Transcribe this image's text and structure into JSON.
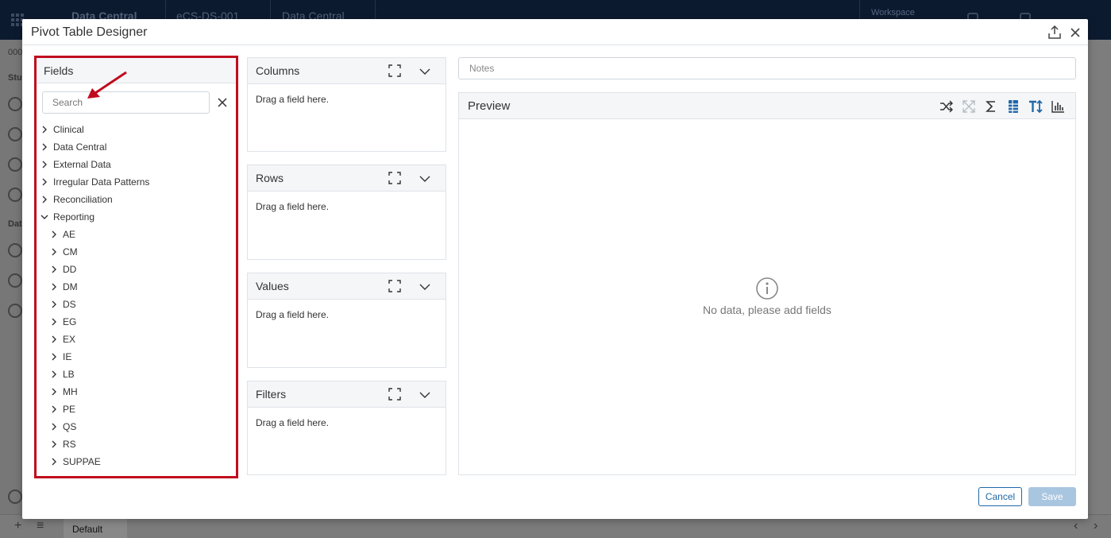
{
  "background": {
    "topbar_items": [
      "Data Central",
      "eCS-DS-001",
      "Data Central"
    ],
    "workspace_label": "Workspace",
    "left_labels": [
      "000",
      "Stu",
      "Dat"
    ],
    "bottom_tab": "Default"
  },
  "dialog": {
    "title": "Pivot Table Designer",
    "icons": {
      "export": "export-icon",
      "close": "close-icon"
    }
  },
  "fields": {
    "title": "Fields",
    "search_placeholder": "Search",
    "tree": [
      {
        "label": "Clinical",
        "expanded": false,
        "level": 0
      },
      {
        "label": "Data Central",
        "expanded": false,
        "level": 0
      },
      {
        "label": "External Data",
        "expanded": false,
        "level": 0
      },
      {
        "label": "Irregular Data Patterns",
        "expanded": false,
        "level": 0
      },
      {
        "label": "Reconciliation",
        "expanded": false,
        "level": 0
      },
      {
        "label": "Reporting",
        "expanded": true,
        "level": 0
      },
      {
        "label": "AE",
        "expanded": false,
        "level": 1
      },
      {
        "label": "CM",
        "expanded": false,
        "level": 1
      },
      {
        "label": "DD",
        "expanded": false,
        "level": 1
      },
      {
        "label": "DM",
        "expanded": false,
        "level": 1
      },
      {
        "label": "DS",
        "expanded": false,
        "level": 1
      },
      {
        "label": "EG",
        "expanded": false,
        "level": 1
      },
      {
        "label": "EX",
        "expanded": false,
        "level": 1
      },
      {
        "label": "IE",
        "expanded": false,
        "level": 1
      },
      {
        "label": "LB",
        "expanded": false,
        "level": 1
      },
      {
        "label": "MH",
        "expanded": false,
        "level": 1
      },
      {
        "label": "PE",
        "expanded": false,
        "level": 1
      },
      {
        "label": "QS",
        "expanded": false,
        "level": 1
      },
      {
        "label": "RS",
        "expanded": false,
        "level": 1
      },
      {
        "label": "SUPPAE",
        "expanded": false,
        "level": 1
      }
    ]
  },
  "zones": [
    {
      "title": "Columns",
      "hint": "Drag a field here."
    },
    {
      "title": "Rows",
      "hint": "Drag a field here."
    },
    {
      "title": "Values",
      "hint": "Drag a field here."
    },
    {
      "title": "Filters",
      "hint": "Drag a field here."
    }
  ],
  "notes": {
    "placeholder": "Notes"
  },
  "preview": {
    "title": "Preview",
    "toolbar_icons": [
      "shuffle-icon",
      "expand-all-icon",
      "sigma-icon",
      "grid-icon",
      "text-height-icon",
      "bar-chart-icon"
    ],
    "empty_message": "No data, please add fields"
  },
  "footer": {
    "cancel": "Cancel",
    "save": "Save"
  },
  "colors": {
    "accent": "#2068a8",
    "annotation": "#c00d1e",
    "save_disabled": "#a9c6e0"
  }
}
